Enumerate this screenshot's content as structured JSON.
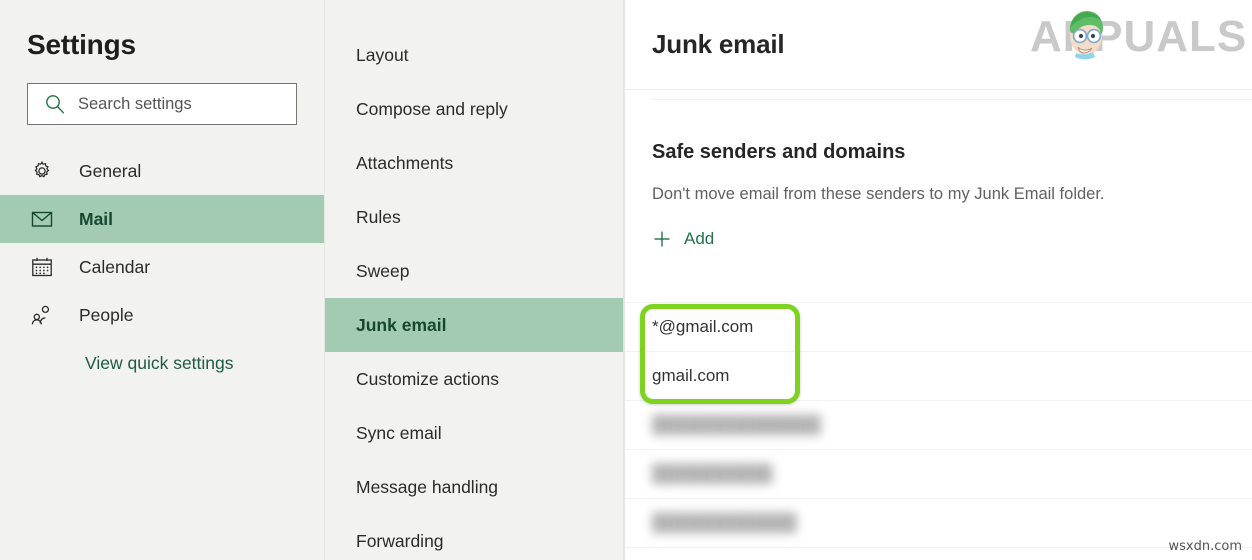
{
  "sidebar": {
    "title": "Settings",
    "search": {
      "placeholder": "Search settings",
      "value": "",
      "icon": "search-icon"
    },
    "items": [
      {
        "label": "General",
        "icon": "gear-icon",
        "active": false
      },
      {
        "label": "Mail",
        "icon": "envelope-icon",
        "active": true
      },
      {
        "label": "Calendar",
        "icon": "calendar-icon",
        "active": false
      },
      {
        "label": "People",
        "icon": "people-icon",
        "active": false
      }
    ],
    "quick_settings_label": "View quick settings"
  },
  "midcolumn": {
    "items": [
      {
        "label": "Layout",
        "active": false
      },
      {
        "label": "Compose and reply",
        "active": false
      },
      {
        "label": "Attachments",
        "active": false
      },
      {
        "label": "Rules",
        "active": false
      },
      {
        "label": "Sweep",
        "active": false
      },
      {
        "label": "Junk email",
        "active": true
      },
      {
        "label": "Customize actions",
        "active": false
      },
      {
        "label": "Sync email",
        "active": false
      },
      {
        "label": "Message handling",
        "active": false
      },
      {
        "label": "Forwarding",
        "active": false
      }
    ]
  },
  "main": {
    "title": "Junk email",
    "section_title": "Safe senders and domains",
    "section_description": "Don't move email from these senders to my Junk Email folder.",
    "add_button": {
      "label": "Add",
      "icon": "plus-icon"
    },
    "list": [
      {
        "value": "*@gmail.com",
        "redacted": false
      },
      {
        "value": "gmail.com",
        "redacted": false
      },
      {
        "value": "",
        "redacted": true
      },
      {
        "value": "",
        "redacted": true
      },
      {
        "value": "",
        "redacted": true
      }
    ]
  },
  "branding": {
    "logo_text": "APPUALS",
    "logo_icon": "appuals-mascot-icon",
    "watermark": "wsxdn.com"
  },
  "colors": {
    "accent_green": "#217346",
    "highlight_green": "#a2cbb1",
    "annotation_green": "#7ed321",
    "panel_bg": "#f2f2f0",
    "main_bg": "#ffffff",
    "logo_gray": "#c9c9c9"
  }
}
